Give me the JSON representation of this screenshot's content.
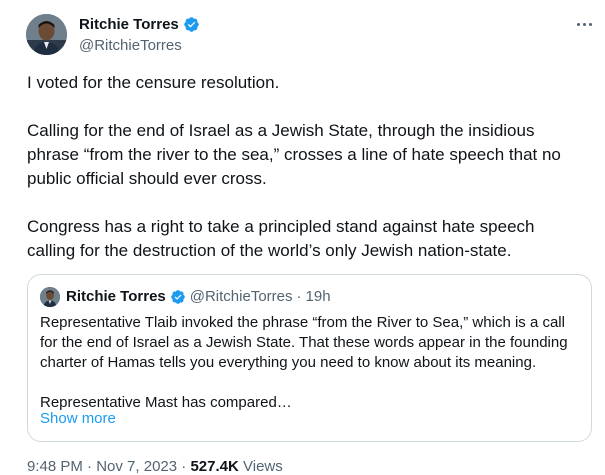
{
  "author": {
    "name": "Ritchie Torres",
    "handle": "@RitchieTorres"
  },
  "tweet": {
    "text": "I voted for the censure resolution.\n\nCalling for the end of Israel as a Jewish State, through the insidious phrase “from the river to the sea,” crosses a line of hate speech that no public official should ever cross.\n\nCongress has a right to take a principled stand against hate speech calling for the destruction of the world’s only Jewish nation-state."
  },
  "quoted": {
    "name": "Ritchie Torres",
    "handle": "@RitchieTorres",
    "separator": "·",
    "time": "19h",
    "text": "Representative Tlaib invoked the phrase “from the River to Sea,” which is a call for the end of Israel as a Jewish State. That these words appear in the founding charter of Hamas tells you everything you need to know about its meaning.\n\nRepresentative Mast has compared…",
    "show_more": "Show more"
  },
  "footer": {
    "time": "9:48 PM",
    "sep1": "·",
    "date": "Nov 7, 2023",
    "sep2": "·",
    "views_count": "527.4K",
    "views_label": "Views"
  },
  "colors": {
    "verified": "#1d9bf0",
    "link": "#1d9bf0",
    "secondary_text": "#536471"
  },
  "icons": {
    "verified": "verified-badge-icon",
    "more": "more-options-icon"
  }
}
